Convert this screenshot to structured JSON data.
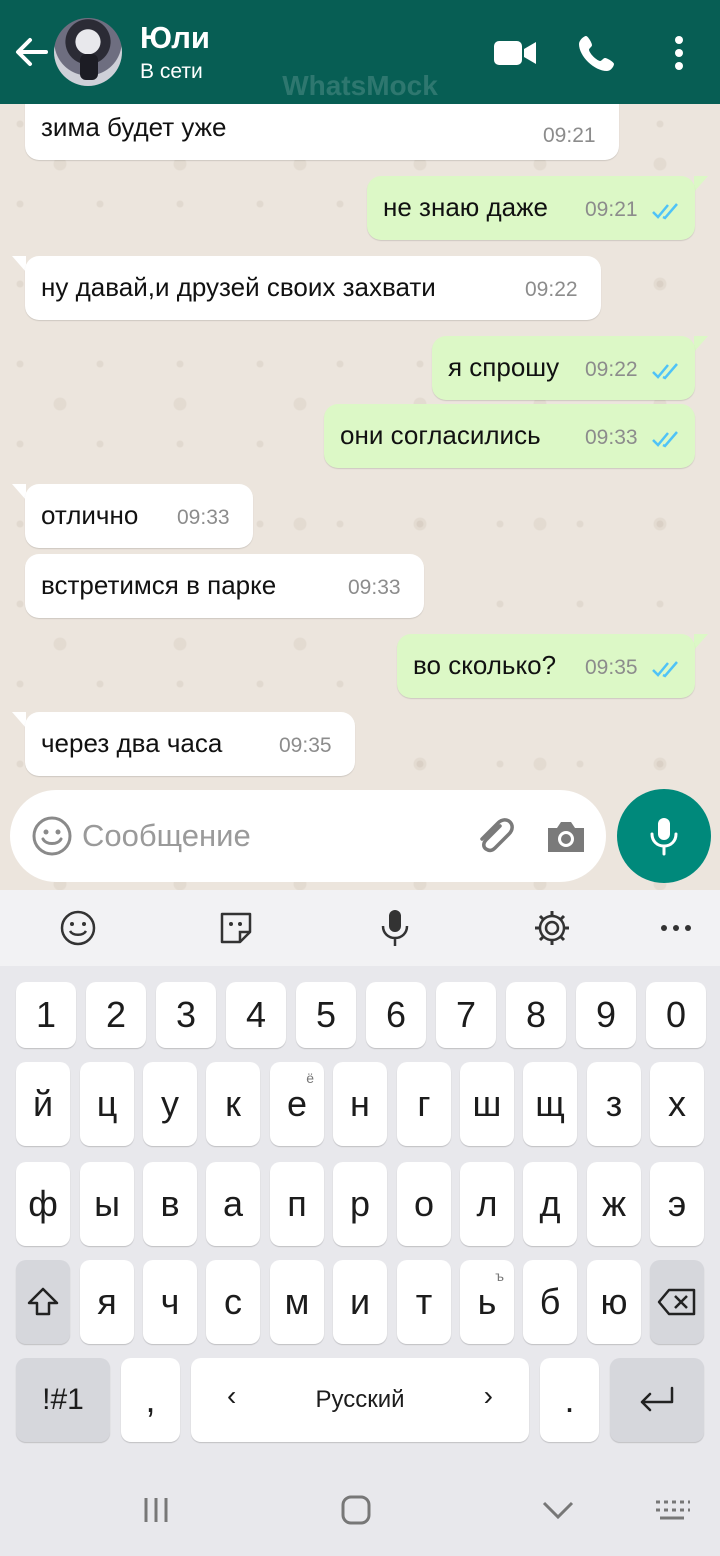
{
  "header": {
    "contact_name": "Юли",
    "contact_status": "В сети",
    "watermark": "WhatsMock",
    "colors": {
      "bar": "#075e54",
      "accent": "#00897b"
    }
  },
  "messages": [
    {
      "direction": "in",
      "text": "зима будет уже",
      "time": "09:21"
    },
    {
      "direction": "out",
      "text": "не знаю даже",
      "time": "09:21",
      "status": "read"
    },
    {
      "direction": "in",
      "text": "ну давай,и друзей своих захвати",
      "time": "09:22"
    },
    {
      "direction": "out",
      "text": "я спрошу",
      "time": "09:22",
      "status": "read"
    },
    {
      "direction": "out",
      "text": "они согласились",
      "time": "09:33",
      "status": "read"
    },
    {
      "direction": "in",
      "text": "отлично",
      "time": "09:33"
    },
    {
      "direction": "in",
      "text": "встретимся в парке",
      "time": "09:33"
    },
    {
      "direction": "out",
      "text": "во сколько?",
      "time": "09:35",
      "status": "read"
    },
    {
      "direction": "in",
      "text": "через два часа",
      "time": "09:35"
    }
  ],
  "composer": {
    "placeholder": "Сообщение"
  },
  "keyboard": {
    "toolbar_icons": [
      "emoji-icon",
      "sticker-icon",
      "voice-input-icon",
      "settings-icon",
      "more-icon"
    ],
    "row_numbers": [
      "1",
      "2",
      "3",
      "4",
      "5",
      "6",
      "7",
      "8",
      "9",
      "0"
    ],
    "row1": [
      "й",
      "ц",
      "у",
      "к",
      "е",
      "н",
      "г",
      "ш",
      "щ",
      "з",
      "х"
    ],
    "row1_alt_e": "ё",
    "row2": [
      "ф",
      "ы",
      "в",
      "а",
      "п",
      "р",
      "о",
      "л",
      "д",
      "ж",
      "э"
    ],
    "row3": [
      "я",
      "ч",
      "с",
      "м",
      "и",
      "т",
      "ь",
      "б",
      "ю"
    ],
    "row3_alt_soft": "ъ",
    "symbols_label": "!#1",
    "comma": ",",
    "language_label": "Русский",
    "left_arrow": "‹",
    "right_arrow": "›",
    "period": "."
  },
  "navbar": {
    "icons": [
      "recents-icon",
      "home-icon",
      "back-icon",
      "keyboard-switch-icon"
    ]
  }
}
